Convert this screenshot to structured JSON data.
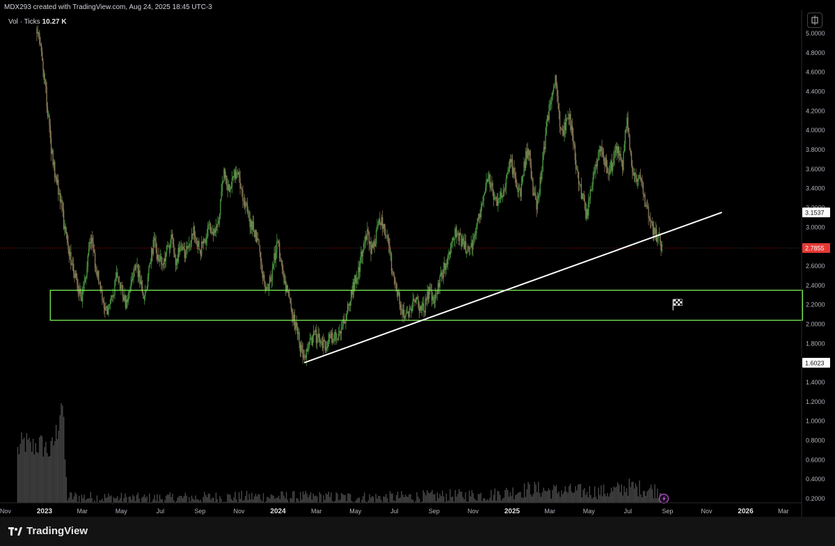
{
  "header": {
    "attribution": "MDX293 created with TradingView.com, Aug 24, 2025 18:45 UTC-3"
  },
  "volume": {
    "label": "Vol · Ticks",
    "value": "10.27 K"
  },
  "footer": {
    "brand": "TradingView"
  },
  "colors": {
    "background": "#000000",
    "candle_up": "#4a9440",
    "candle_down": "#8a7a58",
    "volume_bar": "#4a4a4a",
    "trendline": "#ffffff",
    "zone": "#7ff35a",
    "current_price_label": "#e53935"
  },
  "icons": [
    "settings-icon",
    "finish-flag-icon",
    "lightning-icon",
    "tradingview-logo-icon"
  ],
  "chart_data": {
    "type": "candlestick",
    "x_tick_labels": [
      "Nov",
      "2023",
      "Mar",
      "May",
      "Jul",
      "Sep",
      "Nov",
      "2024",
      "Mar",
      "May",
      "Jul",
      "Sep",
      "Nov",
      "2025",
      "Mar",
      "May",
      "Jul",
      "Sep",
      "Nov",
      "2026",
      "Mar"
    ],
    "y_tick_labels": [
      "0.2000",
      "0.4000",
      "0.6000",
      "0.8000",
      "1.0000",
      "1.2000",
      "1.4000",
      "1.6000",
      "1.8000",
      "2.0000",
      "2.2000",
      "2.4000",
      "2.6000",
      "2.8000",
      "3.0000",
      "3.2000",
      "3.4000",
      "3.6000",
      "3.8000",
      "4.0000",
      "4.2000",
      "4.4000",
      "4.6000",
      "4.8000",
      "5.0000"
    ],
    "ylim": [
      0.1,
      5.15
    ],
    "price_labels": [
      {
        "name": "trendline-end",
        "value": 3.1537,
        "text": "3.1537"
      },
      {
        "name": "current-price",
        "value": 2.7855,
        "text": "2.7855"
      },
      {
        "name": "trendline-start",
        "value": 1.6023,
        "text": "1.6023"
      }
    ],
    "price_series": [
      {
        "date": "2022-12-20",
        "price": 5.05
      },
      {
        "date": "2022-12-27",
        "price": 4.8
      },
      {
        "date": "2023-01-03",
        "price": 4.4
      },
      {
        "date": "2023-01-10",
        "price": 3.9
      },
      {
        "date": "2023-01-17",
        "price": 3.55
      },
      {
        "date": "2023-01-24",
        "price": 3.35
      },
      {
        "date": "2023-01-31",
        "price": 3.05
      },
      {
        "date": "2023-02-07",
        "price": 2.75
      },
      {
        "date": "2023-02-14",
        "price": 2.6
      },
      {
        "date": "2023-02-21",
        "price": 2.45
      },
      {
        "date": "2023-02-28",
        "price": 2.25
      },
      {
        "date": "2023-03-07",
        "price": 2.55
      },
      {
        "date": "2023-03-14",
        "price": 2.9
      },
      {
        "date": "2023-03-21",
        "price": 2.65
      },
      {
        "date": "2023-03-28",
        "price": 2.4
      },
      {
        "date": "2023-04-04",
        "price": 2.2
      },
      {
        "date": "2023-04-11",
        "price": 2.15
      },
      {
        "date": "2023-04-18",
        "price": 2.3
      },
      {
        "date": "2023-04-25",
        "price": 2.55
      },
      {
        "date": "2023-05-02",
        "price": 2.35
      },
      {
        "date": "2023-05-09",
        "price": 2.2
      },
      {
        "date": "2023-05-16",
        "price": 2.4
      },
      {
        "date": "2023-05-23",
        "price": 2.65
      },
      {
        "date": "2023-05-30",
        "price": 2.45
      },
      {
        "date": "2023-06-06",
        "price": 2.25
      },
      {
        "date": "2023-06-13",
        "price": 2.55
      },
      {
        "date": "2023-06-20",
        "price": 2.85
      },
      {
        "date": "2023-06-27",
        "price": 2.7
      },
      {
        "date": "2023-07-04",
        "price": 2.6
      },
      {
        "date": "2023-07-11",
        "price": 2.75
      },
      {
        "date": "2023-07-18",
        "price": 2.9
      },
      {
        "date": "2023-07-25",
        "price": 2.65
      },
      {
        "date": "2023-08-01",
        "price": 2.8
      },
      {
        "date": "2023-08-08",
        "price": 2.7
      },
      {
        "date": "2023-08-15",
        "price": 2.85
      },
      {
        "date": "2023-08-22",
        "price": 2.95
      },
      {
        "date": "2023-09-01",
        "price": 2.75
      },
      {
        "date": "2023-09-08",
        "price": 2.85
      },
      {
        "date": "2023-09-15",
        "price": 3.0
      },
      {
        "date": "2023-09-22",
        "price": 2.9
      },
      {
        "date": "2023-10-01",
        "price": 3.1
      },
      {
        "date": "2023-10-08",
        "price": 3.55
      },
      {
        "date": "2023-10-15",
        "price": 3.4
      },
      {
        "date": "2023-10-22",
        "price": 3.5
      },
      {
        "date": "2023-10-29",
        "price": 3.6
      },
      {
        "date": "2023-11-05",
        "price": 3.4
      },
      {
        "date": "2023-11-12",
        "price": 3.2
      },
      {
        "date": "2023-11-19",
        "price": 3.05
      },
      {
        "date": "2023-11-26",
        "price": 2.95
      },
      {
        "date": "2023-12-03",
        "price": 2.75
      },
      {
        "date": "2023-12-10",
        "price": 2.45
      },
      {
        "date": "2023-12-17",
        "price": 2.35
      },
      {
        "date": "2023-12-24",
        "price": 2.6
      },
      {
        "date": "2023-12-31",
        "price": 2.85
      },
      {
        "date": "2024-01-07",
        "price": 2.6
      },
      {
        "date": "2024-01-14",
        "price": 2.35
      },
      {
        "date": "2024-01-21",
        "price": 2.15
      },
      {
        "date": "2024-01-28",
        "price": 2.0
      },
      {
        "date": "2024-02-04",
        "price": 1.8
      },
      {
        "date": "2024-02-11",
        "price": 1.62
      },
      {
        "date": "2024-02-18",
        "price": 1.75
      },
      {
        "date": "2024-02-25",
        "price": 1.9
      },
      {
        "date": "2024-03-03",
        "price": 1.85
      },
      {
        "date": "2024-03-10",
        "price": 1.78
      },
      {
        "date": "2024-03-17",
        "price": 1.8
      },
      {
        "date": "2024-03-24",
        "price": 1.88
      },
      {
        "date": "2024-03-31",
        "price": 1.85
      },
      {
        "date": "2024-04-07",
        "price": 1.95
      },
      {
        "date": "2024-04-14",
        "price": 2.05
      },
      {
        "date": "2024-04-21",
        "price": 2.2
      },
      {
        "date": "2024-04-28",
        "price": 2.4
      },
      {
        "date": "2024-05-05",
        "price": 2.55
      },
      {
        "date": "2024-05-12",
        "price": 2.75
      },
      {
        "date": "2024-05-19",
        "price": 2.95
      },
      {
        "date": "2024-05-26",
        "price": 2.75
      },
      {
        "date": "2024-06-02",
        "price": 2.9
      },
      {
        "date": "2024-06-09",
        "price": 3.1
      },
      {
        "date": "2024-06-16",
        "price": 3.0
      },
      {
        "date": "2024-06-23",
        "price": 2.75
      },
      {
        "date": "2024-06-30",
        "price": 2.45
      },
      {
        "date": "2024-07-07",
        "price": 2.3
      },
      {
        "date": "2024-07-14",
        "price": 2.15
      },
      {
        "date": "2024-07-21",
        "price": 2.05
      },
      {
        "date": "2024-07-28",
        "price": 2.2
      },
      {
        "date": "2024-08-04",
        "price": 2.3
      },
      {
        "date": "2024-08-11",
        "price": 2.1
      },
      {
        "date": "2024-08-18",
        "price": 2.2
      },
      {
        "date": "2024-08-25",
        "price": 2.35
      },
      {
        "date": "2024-09-01",
        "price": 2.25
      },
      {
        "date": "2024-09-08",
        "price": 2.4
      },
      {
        "date": "2024-09-15",
        "price": 2.55
      },
      {
        "date": "2024-09-22",
        "price": 2.7
      },
      {
        "date": "2024-09-29",
        "price": 2.85
      },
      {
        "date": "2024-10-06",
        "price": 2.95
      },
      {
        "date": "2024-10-13",
        "price": 2.85
      },
      {
        "date": "2024-10-20",
        "price": 2.8
      },
      {
        "date": "2024-10-27",
        "price": 2.75
      },
      {
        "date": "2024-11-03",
        "price": 2.9
      },
      {
        "date": "2024-11-10",
        "price": 3.1
      },
      {
        "date": "2024-11-17",
        "price": 3.35
      },
      {
        "date": "2024-11-24",
        "price": 3.55
      },
      {
        "date": "2024-12-01",
        "price": 3.4
      },
      {
        "date": "2024-12-08",
        "price": 3.2
      },
      {
        "date": "2024-12-15",
        "price": 3.3
      },
      {
        "date": "2024-12-22",
        "price": 3.5
      },
      {
        "date": "2024-12-29",
        "price": 3.7
      },
      {
        "date": "2025-01-05",
        "price": 3.5
      },
      {
        "date": "2025-01-12",
        "price": 3.3
      },
      {
        "date": "2025-01-19",
        "price": 3.6
      },
      {
        "date": "2025-01-26",
        "price": 3.85
      },
      {
        "date": "2025-02-02",
        "price": 3.4
      },
      {
        "date": "2025-02-09",
        "price": 3.2
      },
      {
        "date": "2025-02-16",
        "price": 3.6
      },
      {
        "date": "2025-02-23",
        "price": 4.0
      },
      {
        "date": "2025-03-02",
        "price": 4.3
      },
      {
        "date": "2025-03-09",
        "price": 4.55
      },
      {
        "date": "2025-03-16",
        "price": 4.1
      },
      {
        "date": "2025-03-23",
        "price": 4.0
      },
      {
        "date": "2025-03-30",
        "price": 4.2
      },
      {
        "date": "2025-04-06",
        "price": 3.9
      },
      {
        "date": "2025-04-13",
        "price": 3.55
      },
      {
        "date": "2025-04-20",
        "price": 3.3
      },
      {
        "date": "2025-04-27",
        "price": 3.1
      },
      {
        "date": "2025-05-04",
        "price": 3.35
      },
      {
        "date": "2025-05-11",
        "price": 3.6
      },
      {
        "date": "2025-05-18",
        "price": 3.85
      },
      {
        "date": "2025-05-25",
        "price": 3.7
      },
      {
        "date": "2025-06-01",
        "price": 3.55
      },
      {
        "date": "2025-06-08",
        "price": 3.7
      },
      {
        "date": "2025-06-15",
        "price": 3.8
      },
      {
        "date": "2025-06-22",
        "price": 3.6
      },
      {
        "date": "2025-06-29",
        "price": 4.1
      },
      {
        "date": "2025-07-06",
        "price": 3.7
      },
      {
        "date": "2025-07-13",
        "price": 3.45
      },
      {
        "date": "2025-07-20",
        "price": 3.55
      },
      {
        "date": "2025-07-27",
        "price": 3.25
      },
      {
        "date": "2025-08-03",
        "price": 3.1
      },
      {
        "date": "2025-08-10",
        "price": 2.95
      },
      {
        "date": "2025-08-17",
        "price": 2.88
      },
      {
        "date": "2025-08-24",
        "price": 2.79
      }
    ],
    "volume_series": [
      {
        "date": "2022-11-20",
        "ticks": 0.75
      },
      {
        "date": "2022-12-01",
        "ticks": 0.85
      },
      {
        "date": "2022-12-10",
        "ticks": 0.78
      },
      {
        "date": "2022-12-20",
        "ticks": 0.82
      },
      {
        "date": "2023-01-01",
        "ticks": 0.8
      },
      {
        "date": "2023-01-10",
        "ticks": 0.72
      },
      {
        "date": "2023-01-20",
        "ticks": 0.95
      },
      {
        "date": "2023-01-28",
        "ticks": 1.4
      },
      {
        "date": "2023-02-05",
        "ticks": 0.22
      },
      {
        "date": "2023-06-01",
        "ticks": 0.2
      },
      {
        "date": "2023-12-01",
        "ticks": 0.22
      },
      {
        "date": "2024-06-01",
        "ticks": 0.21
      },
      {
        "date": "2024-12-01",
        "ticks": 0.24
      },
      {
        "date": "2025-02-01",
        "ticks": 0.3
      },
      {
        "date": "2025-03-01",
        "ticks": 0.28
      },
      {
        "date": "2025-06-01",
        "ticks": 0.27
      },
      {
        "date": "2025-07-01",
        "ticks": 0.32
      },
      {
        "date": "2025-08-24",
        "ticks": 0.28
      }
    ],
    "trendline": {
      "start": {
        "date": "2024-02-11",
        "price": 1.6023
      },
      "end": {
        "date": "2025-11-25",
        "price": 3.1537
      }
    },
    "zone": {
      "start_date": "2023-01-10",
      "end_date": "2026-03-31",
      "price_low": 2.04,
      "price_high": 2.35
    },
    "flag_marker": {
      "date": "2025-09-15",
      "price": 2.2
    },
    "event_marker": {
      "date": "2025-08-24",
      "price": 0.2
    }
  }
}
